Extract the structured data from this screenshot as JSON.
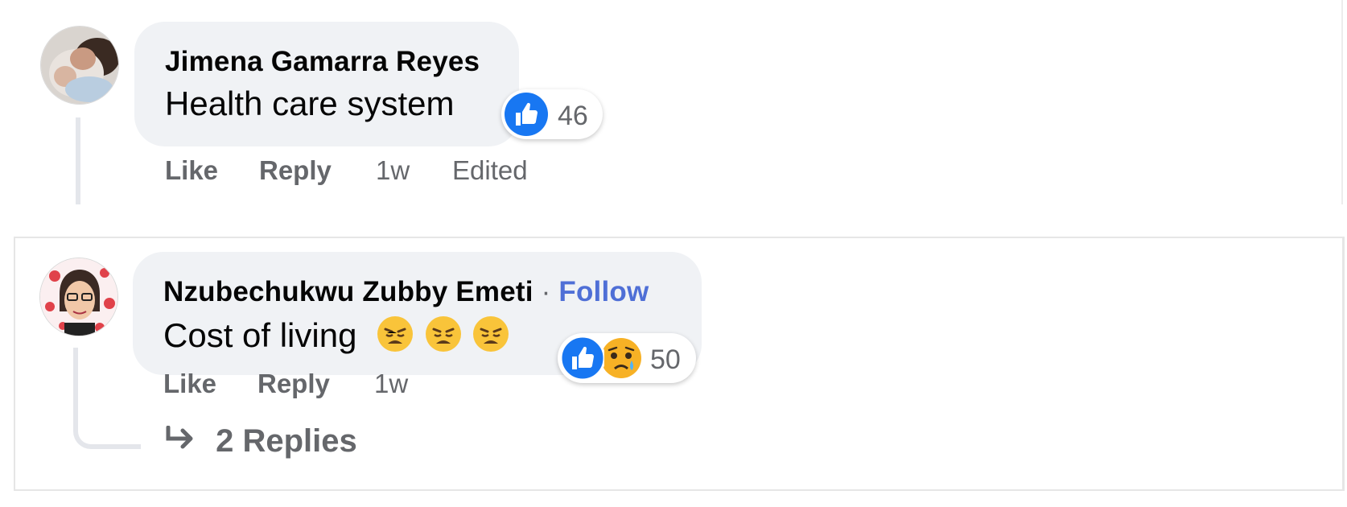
{
  "comments": [
    {
      "author": "Jimena Gamarra Reyes",
      "text": "Health care system",
      "reaction_count": "46",
      "actions": {
        "like": "Like",
        "reply": "Reply",
        "time": "1w",
        "edited": "Edited"
      },
      "reactions": [
        "like-icon"
      ]
    },
    {
      "author": "Nzubechukwu Zubby Emeti",
      "separator": "·",
      "follow": "Follow",
      "text": "Cost of living",
      "reaction_count": "50",
      "actions": {
        "like": "Like",
        "reply": "Reply",
        "time": "1w"
      },
      "reactions": [
        "like-icon",
        "sad-icon"
      ],
      "replies_label": "2 Replies"
    }
  ],
  "colors": {
    "bubble": "#f0f2f5",
    "like_blue": "#1877f2",
    "follow": "#4f6fd6",
    "muted": "#65676b"
  }
}
